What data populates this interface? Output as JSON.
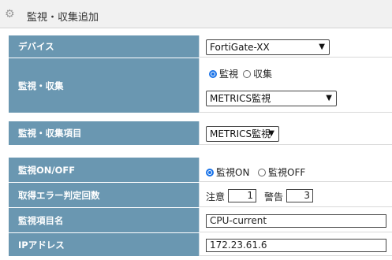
{
  "header": {
    "title": "監視・収集追加",
    "icon": "gear-icon"
  },
  "rows": {
    "device": {
      "label": "デバイス",
      "select_value": "FortiGate-XX"
    },
    "monitor_collect": {
      "label": "監視・収集",
      "radio_monitor": "監視",
      "radio_collect": "収集",
      "select_value": "METRICS監視"
    },
    "item": {
      "label": "監視・収集項目",
      "select_value": "METRICS監視"
    },
    "onoff": {
      "label": "監視ON/OFF",
      "radio_on": "監視ON",
      "radio_off": "監視OFF"
    },
    "error_count": {
      "label": "取得エラー判定回数",
      "caution_label": "注意",
      "caution_value": "1",
      "warning_label": "警告",
      "warning_value": "3"
    },
    "item_name": {
      "label": "監視項目名",
      "value": "CPU-current"
    },
    "ip": {
      "label": "IPアドレス",
      "value": "172.23.61.6"
    }
  },
  "colors": {
    "label_bg": "#6a97b1",
    "accent": "#1a73e8"
  }
}
